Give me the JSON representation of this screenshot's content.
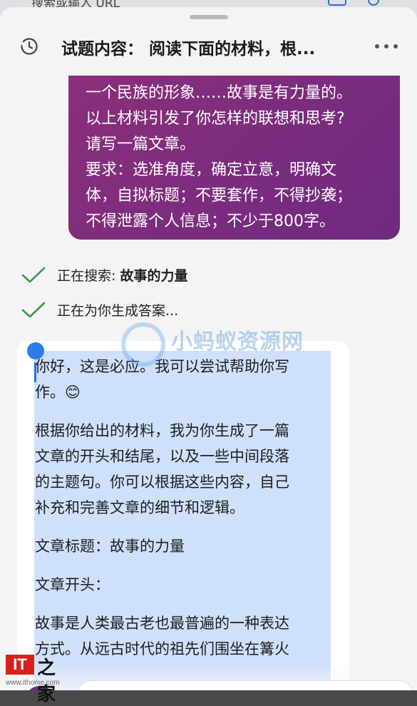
{
  "search_bar": {
    "text": "搜索或输入 URL"
  },
  "header": {
    "title": "试题内容： 阅读下面的材料，根..."
  },
  "user_message": {
    "lines": [
      "一个民族的形象……故事是有力量的。",
      "以上材料引发了你怎样的联想和思考?",
      "请写一篇文章。",
      "要求：选准角度，确定立意，明确文",
      "体，自拟标题；不要套作，不得抄袭；",
      "不得泄露个人信息；不少于800字。"
    ]
  },
  "status": [
    {
      "prefix": "正在搜索: ",
      "bold": "故事的力量"
    },
    {
      "prefix": "正在为你生成答案...",
      "bold": ""
    }
  ],
  "watermark": {
    "text": "小蚂蚁资源网"
  },
  "answer": {
    "lines": [
      "你好，这是必应。我可以尝试帮助你写",
      "作。😊",
      "根据你给出的材料，我为你生成了一篇",
      "文章的开头和结尾，以及一些中间段落",
      "的主题句。你可以根据这些内容，自己",
      "补充和完善文章的细节和逻辑。",
      "文章标题：故事的力量",
      "文章开头：",
      "故事是人类最古老也最普遍的一种表达",
      "方式。从远古时代的祖先们围坐在篝火"
    ]
  },
  "footer": {
    "logo_text": "IT",
    "logo_zh": "之家",
    "site": "www.ithome.com"
  }
}
